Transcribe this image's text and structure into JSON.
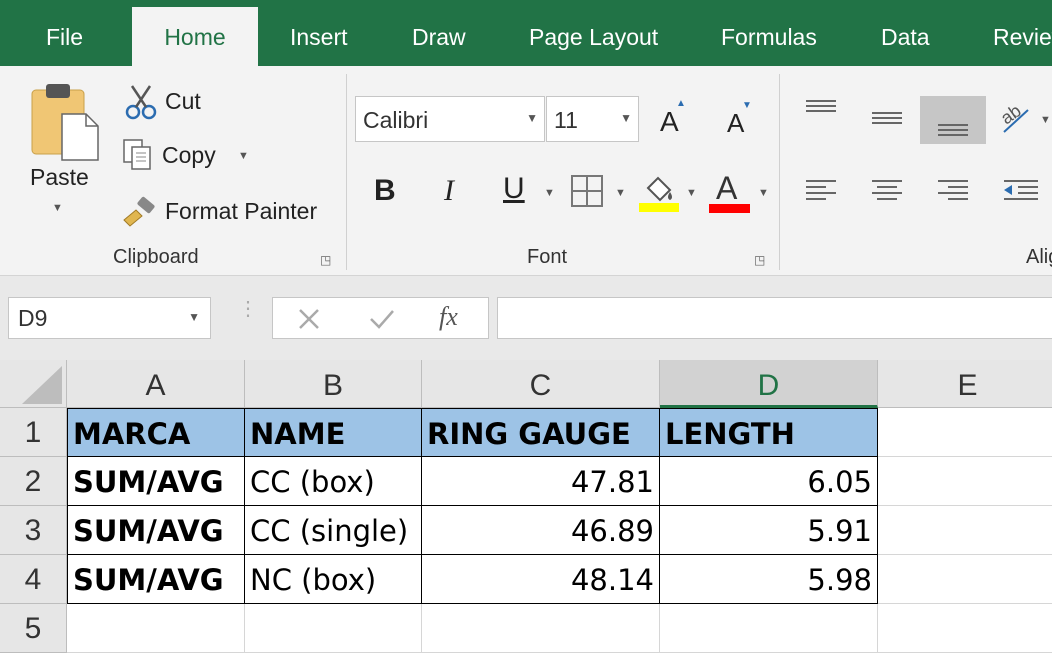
{
  "tabs": [
    "File",
    "Home",
    "Insert",
    "Draw",
    "Page Layout",
    "Formulas",
    "Data",
    "Review"
  ],
  "active_tab": "Home",
  "clipboard": {
    "paste": "Paste",
    "cut": "Cut",
    "copy": "Copy",
    "format_painter": "Format Painter",
    "label": "Clipboard"
  },
  "font": {
    "name": "Calibri",
    "size": "11",
    "label": "Font",
    "bold": "B",
    "italic": "I",
    "underline": "U",
    "grow": "A",
    "shrink": "A",
    "color_letter": "A",
    "highlight_color": "#ffff00",
    "font_color": "#ff0000"
  },
  "alignment": {
    "label": "Alig"
  },
  "formula_bar": {
    "name_box": "D9",
    "fx": "fx",
    "value": ""
  },
  "grid": {
    "columns": [
      "A",
      "B",
      "C",
      "D",
      "E"
    ],
    "selected_column": "D",
    "rows": [
      "1",
      "2",
      "3",
      "4",
      "5"
    ],
    "header": [
      "MARCA",
      "NAME",
      "RING GAUGE",
      "LENGTH"
    ],
    "data": [
      [
        "SUM/AVG",
        "CC (box)",
        "47.81",
        "6.05"
      ],
      [
        "SUM/AVG",
        "CC (single)",
        "46.89",
        "5.91"
      ],
      [
        "SUM/AVG",
        "NC (box)",
        "48.14",
        "5.98"
      ]
    ]
  },
  "colors": {
    "excel_green": "#217346",
    "header_fill": "#9dc3e6"
  }
}
